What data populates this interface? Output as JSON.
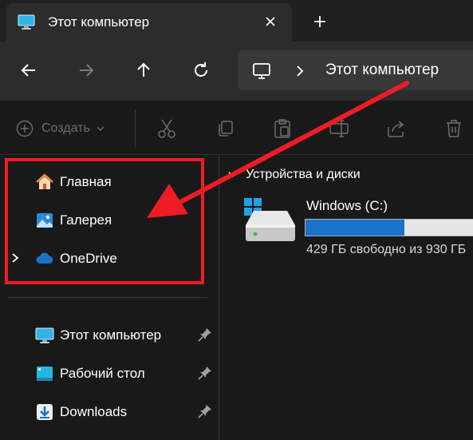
{
  "tab": {
    "title": "Этот компьютер",
    "close_icon": "close-icon",
    "new_tab_icon": "plus-icon"
  },
  "nav": {
    "back_icon": "arrow-left-icon",
    "forward_icon": "arrow-right-icon",
    "up_icon": "arrow-up-icon",
    "refresh_icon": "refresh-icon",
    "address": {
      "location": "Этот компьютер"
    }
  },
  "commandbar": {
    "create_label": "Создать",
    "icons": [
      "cut-icon",
      "copy-icon",
      "paste-icon",
      "rename-icon",
      "share-icon",
      "delete-icon"
    ]
  },
  "sidebar": {
    "pinned_top": [
      {
        "label": "Главная",
        "icon": "home-icon"
      },
      {
        "label": "Галерея",
        "icon": "gallery-icon"
      },
      {
        "label": "OneDrive",
        "icon": "cloud-icon"
      }
    ],
    "quick_access": [
      {
        "label": "Этот компьютер",
        "icon": "computer-icon"
      },
      {
        "label": "Рабочий стол",
        "icon": "desktop-icon"
      },
      {
        "label": "Downloads",
        "icon": "download-icon"
      }
    ]
  },
  "main": {
    "group_title": "Устройства и диски",
    "drives": [
      {
        "name": "Windows (C:)",
        "free_text": "429 ГБ свободно из 930 ГБ",
        "used_fraction": 0.54
      }
    ]
  },
  "colors": {
    "accent": "#1a73c8",
    "highlight": "#ee1c24",
    "background": "#191919"
  }
}
